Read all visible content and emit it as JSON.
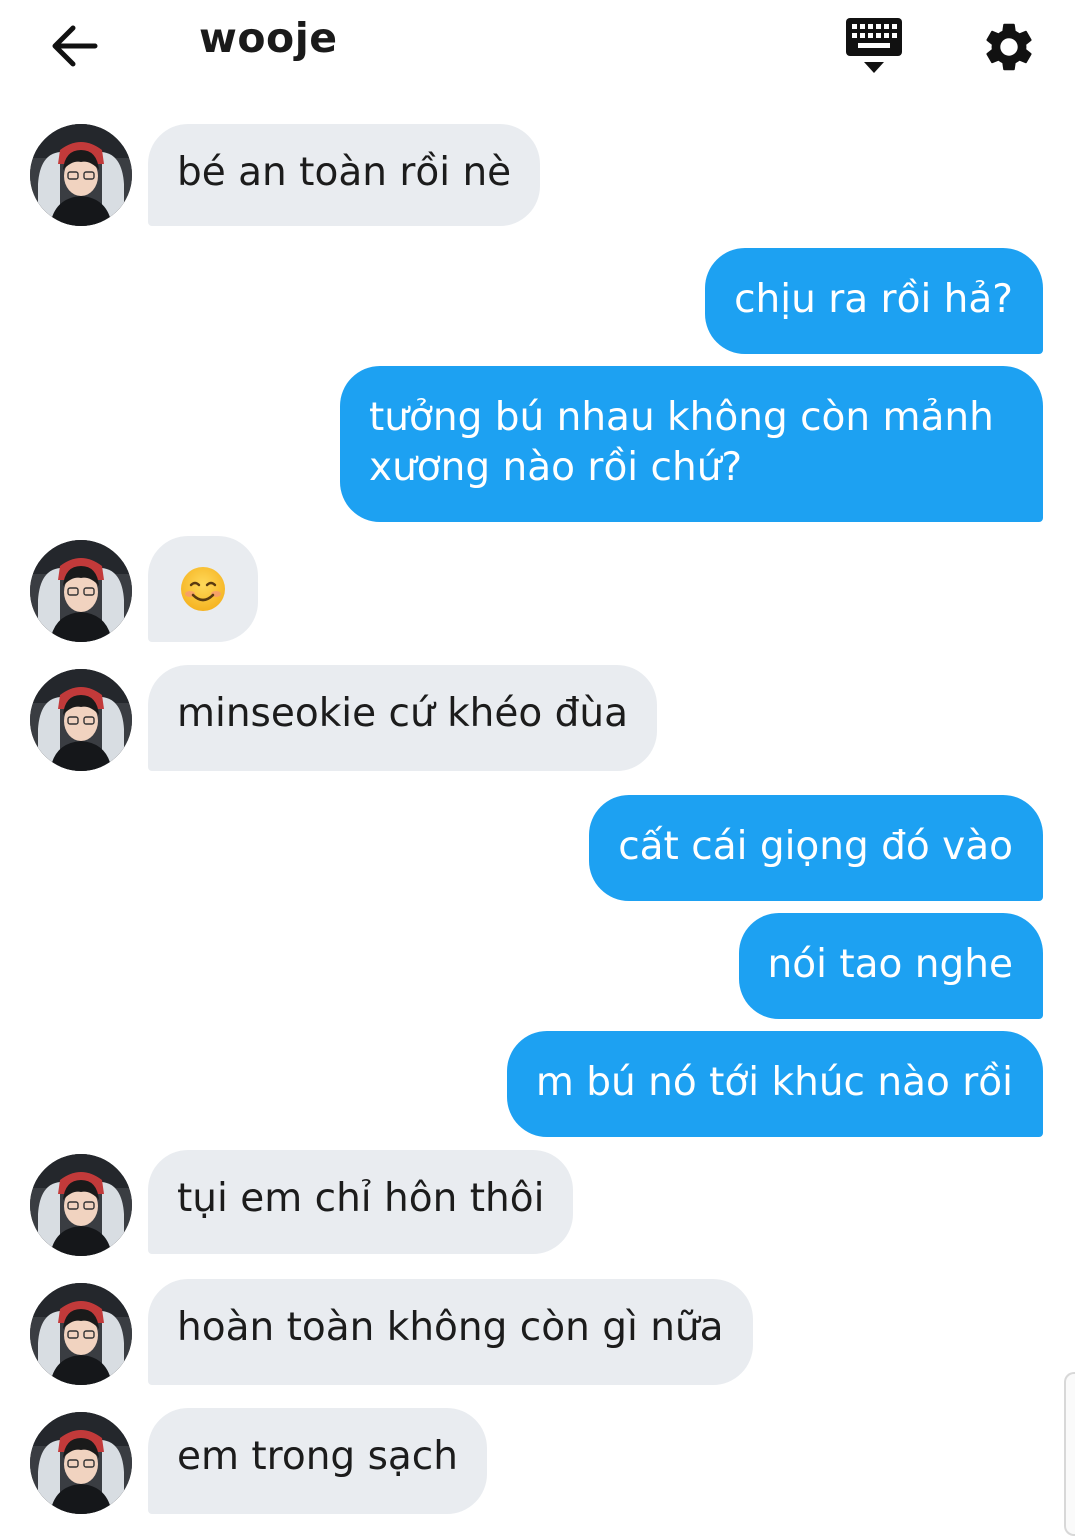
{
  "header": {
    "back_icon": "arrow-left-icon",
    "title": "wooje",
    "keyboard_icon": "keyboard-icon",
    "settings_icon": "gear-icon"
  },
  "colors": {
    "outgoing_bubble": "#1da1f2",
    "incoming_bubble": "#e9ecf0",
    "outgoing_text": "#ffffff",
    "incoming_text": "#1c1c1c"
  },
  "messages": [
    {
      "from": "them",
      "text": "bé an toàn rồi nè"
    },
    {
      "from": "me",
      "text": "chịu ra rồi hả?"
    },
    {
      "from": "me",
      "text": "tưởng bú nhau không còn mảnh xương nào rồi chứ?"
    },
    {
      "from": "them",
      "emoji": "smiling-face-icon"
    },
    {
      "from": "them",
      "text": "minseokie cứ khéo đùa"
    },
    {
      "from": "me",
      "text": "cất cái giọng đó vào"
    },
    {
      "from": "me",
      "text": "nói tao nghe"
    },
    {
      "from": "me",
      "text": "m bú nó tới khúc nào rồi"
    },
    {
      "from": "them",
      "text": "tụi em chỉ hôn thôi"
    },
    {
      "from": "them",
      "text": "hoàn toàn không còn gì nữa"
    },
    {
      "from": "them",
      "text": "em trong sạch"
    }
  ]
}
